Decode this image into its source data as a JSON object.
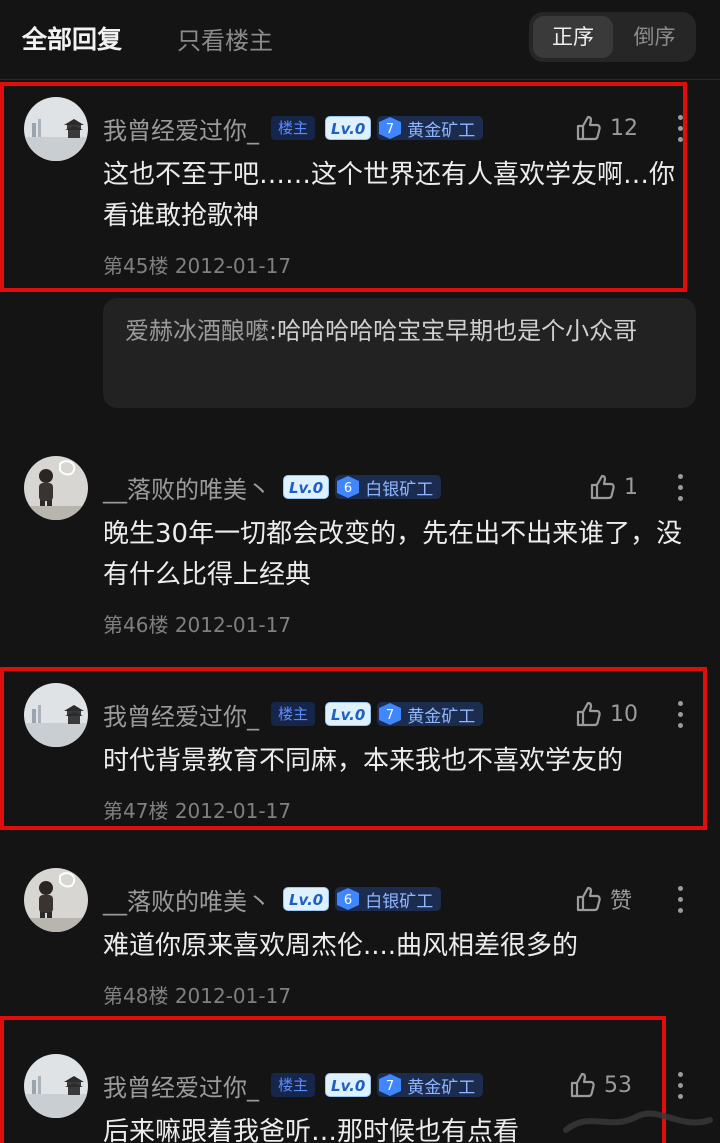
{
  "tabs": {
    "all": "全部回复",
    "op_only": "只看楼主"
  },
  "sort": {
    "asc": "正序",
    "desc": "倒序"
  },
  "comments": [
    {
      "username": "我曾经爱过你_",
      "op_badge": "楼主",
      "level": "Lv.0",
      "rank_num": "7",
      "rank_title": "黄金矿工",
      "likes": "12",
      "content": "这也不至于吧……这个世界还有人喜欢学友啊…你看谁敢抢歌神",
      "floor": "第45楼",
      "date": "2012-01-17",
      "reply": {
        "user": "爱赫冰酒酿嚒",
        "text": ":哈哈哈哈哈宝宝早期也是个小众哥"
      }
    },
    {
      "username": "__落败的唯美丶",
      "level": "Lv.0",
      "rank_num": "6",
      "rank_title": "白银矿工",
      "likes": "1",
      "content": "晚生30年一切都会改变的，先在出不出来谁了，没有什么比得上经典",
      "floor": "第46楼",
      "date": "2012-01-17"
    },
    {
      "username": "我曾经爱过你_",
      "op_badge": "楼主",
      "level": "Lv.0",
      "rank_num": "7",
      "rank_title": "黄金矿工",
      "likes": "10",
      "content": "时代背景教育不同麻，本来我也不喜欢学友的",
      "floor": "第47楼",
      "date": "2012-01-17"
    },
    {
      "username": "__落败的唯美丶",
      "level": "Lv.0",
      "rank_num": "6",
      "rank_title": "白银矿工",
      "likes": "赞",
      "content": "难道你原来喜欢周杰伦....曲风相差很多的",
      "floor": "第48楼",
      "date": "2012-01-17"
    },
    {
      "username": "我曾经爱过你_",
      "op_badge": "楼主",
      "level": "Lv.0",
      "rank_num": "7",
      "rank_title": "黄金矿工",
      "likes": "53",
      "content": "后来嘛跟着我爸听…那时候也有点看",
      "floor": "",
      "date": ""
    }
  ],
  "colors": {
    "background": "#141414",
    "highlight_border": "#e00d0d",
    "rank_gem": "#3f86ff",
    "op_badge_text": "#5a8cff"
  },
  "icons": [
    "thumb-up-icon",
    "more-vertical-icon",
    "rank-gem-icon"
  ]
}
